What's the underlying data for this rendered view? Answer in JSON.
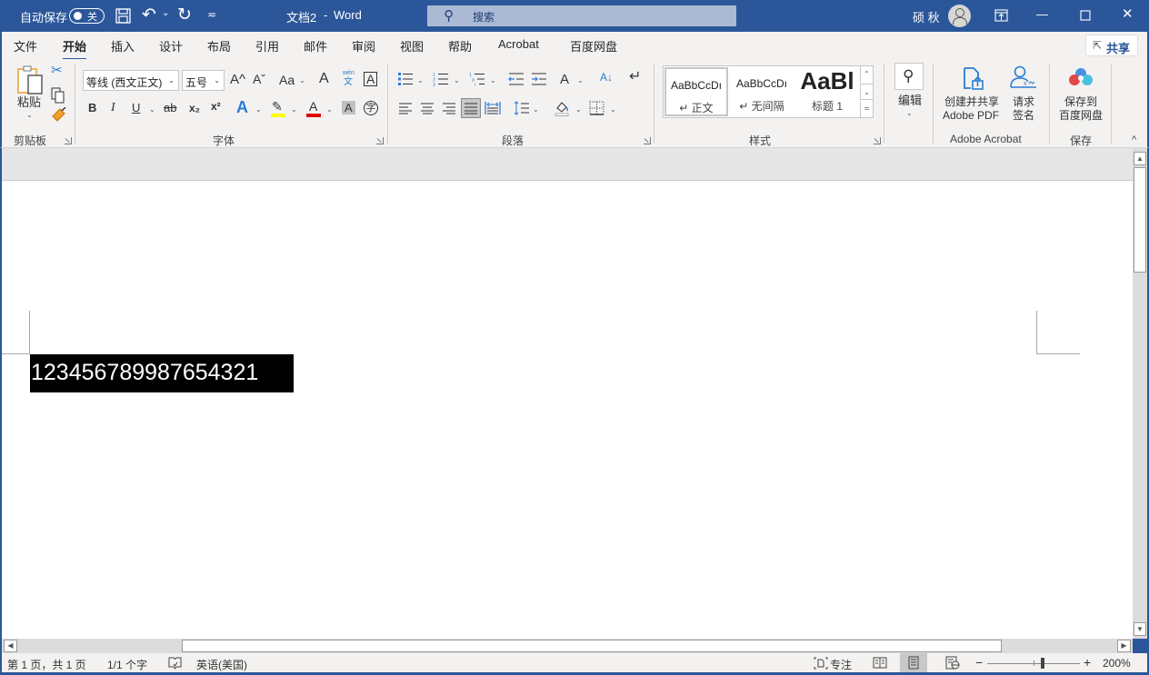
{
  "titlebar": {
    "autosave_label": "自动保存",
    "autosave_state": "关",
    "doc_title": "文档2",
    "separator": "-",
    "app_name": "Word",
    "search_placeholder": "搜索",
    "user_name": "硕 秋",
    "icons": {
      "save": "save-icon",
      "undo": "undo-icon",
      "redo": "redo-icon",
      "customize": "customize-qat-icon",
      "ribbon_display": "ribbon-display-icon",
      "minimize": "minimize-icon",
      "maximize": "maximize-icon",
      "close": "close-icon"
    },
    "glyphs": {
      "undo": "↶",
      "redo": "↻",
      "dropdown": "⌄",
      "customize": "≂",
      "minimize": "—",
      "maximize": "☐",
      "close": "✕",
      "search": "⚲"
    }
  },
  "tabs": [
    {
      "label": "文件",
      "active": false
    },
    {
      "label": "开始",
      "active": true
    },
    {
      "label": "插入",
      "active": false
    },
    {
      "label": "设计",
      "active": false
    },
    {
      "label": "布局",
      "active": false
    },
    {
      "label": "引用",
      "active": false
    },
    {
      "label": "邮件",
      "active": false
    },
    {
      "label": "审阅",
      "active": false
    },
    {
      "label": "视图",
      "active": false
    },
    {
      "label": "帮助",
      "active": false
    },
    {
      "label": "Acrobat",
      "active": false
    },
    {
      "label": "百度网盘",
      "active": false
    }
  ],
  "share_button": {
    "label": "共享",
    "icon": "⇱"
  },
  "ribbon": {
    "clipboard": {
      "group_label": "剪贴板",
      "paste_label": "粘贴",
      "cut_glyph": "✂",
      "copy_glyph": "⎘",
      "format_painter_glyph": "🖌"
    },
    "font": {
      "group_label": "字体",
      "font_name": "等线 (西文正文)",
      "font_size": "五号",
      "grow_font": "A^",
      "shrink_font": "Aˇ",
      "change_case": "Aa",
      "clear_format_glyph": "A",
      "phonetic_top": "wén",
      "phonetic_bottom": "文",
      "char_border": "A",
      "bold": "B",
      "italic": "I",
      "underline": "U",
      "strikethrough": "ab",
      "subscript": "x₂",
      "superscript": "x²",
      "text_effect": "A",
      "highlight_glyph": "✎",
      "font_color": "A",
      "char_shading": "A",
      "enclose_char": "字",
      "highlight_color": "#ffff00",
      "font_color_value": "#e00000",
      "text_effect_color": "#2b7cd3"
    },
    "paragraph": {
      "group_label": "段落",
      "bullets": "☰",
      "numbering": "☰",
      "multilevel": "☰",
      "decrease_indent": "⇤",
      "increase_indent": "⇥",
      "chinese_layout": "A",
      "sort": "A↓",
      "show_marks": "↵",
      "align_left": "≡",
      "align_center": "≡",
      "align_right": "≡",
      "justify": "≡",
      "distribute": "≡",
      "line_spacing": "↕≡",
      "shading": "◇",
      "borders": "⊞"
    },
    "styles": {
      "group_label": "样式",
      "items": [
        {
          "preview": "AaBbCcDı",
          "name": "↵ 正文",
          "selected": true
        },
        {
          "preview": "AaBbCcDı",
          "name": "↵ 无间隔",
          "selected": false
        },
        {
          "preview": "AaBl",
          "name": "标题 1",
          "selected": false
        }
      ]
    },
    "editing": {
      "label": "编辑",
      "glyph": "⚲"
    },
    "acrobat": {
      "group_label": "Adobe Acrobat",
      "create_share_line1": "创建并共享",
      "create_share_line2": "Adobe PDF",
      "request_sign_line1": "请求",
      "request_sign_line2": "签名"
    },
    "save_group": {
      "group_label": "保存",
      "save_to_line1": "保存到",
      "save_to_line2": "百度网盘"
    },
    "collapse_glyph": "^"
  },
  "document": {
    "selected_text": "123456789987654321"
  },
  "statusbar": {
    "page_info": "第 1 页，共 1 页",
    "word_count": "1/1 个字",
    "language": "英语(美国)",
    "focus_label": "专注",
    "zoom_minus": "−",
    "zoom_plus": "+",
    "zoom_level": "200%",
    "zoom_slider_percent": 60
  },
  "colors": {
    "brand": "#2b579a",
    "ribbon_bg": "#f3f2f1",
    "selection_bg": "#000000",
    "selection_fg": "#ffffff"
  }
}
